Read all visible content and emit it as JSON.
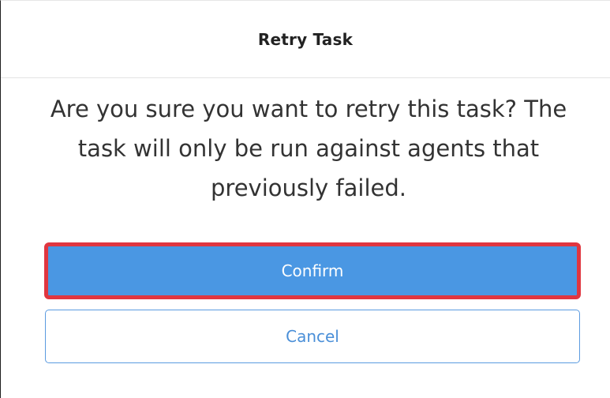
{
  "dialog": {
    "title": "Retry Task",
    "message": "Are you sure you want to retry this task? The task will only be run against agents that previously failed.",
    "confirm_label": "Confirm",
    "cancel_label": "Cancel"
  },
  "colors": {
    "confirm_background": "#4a97e3",
    "confirm_highlight": "#e03640",
    "cancel_text": "#4a8fd8"
  }
}
